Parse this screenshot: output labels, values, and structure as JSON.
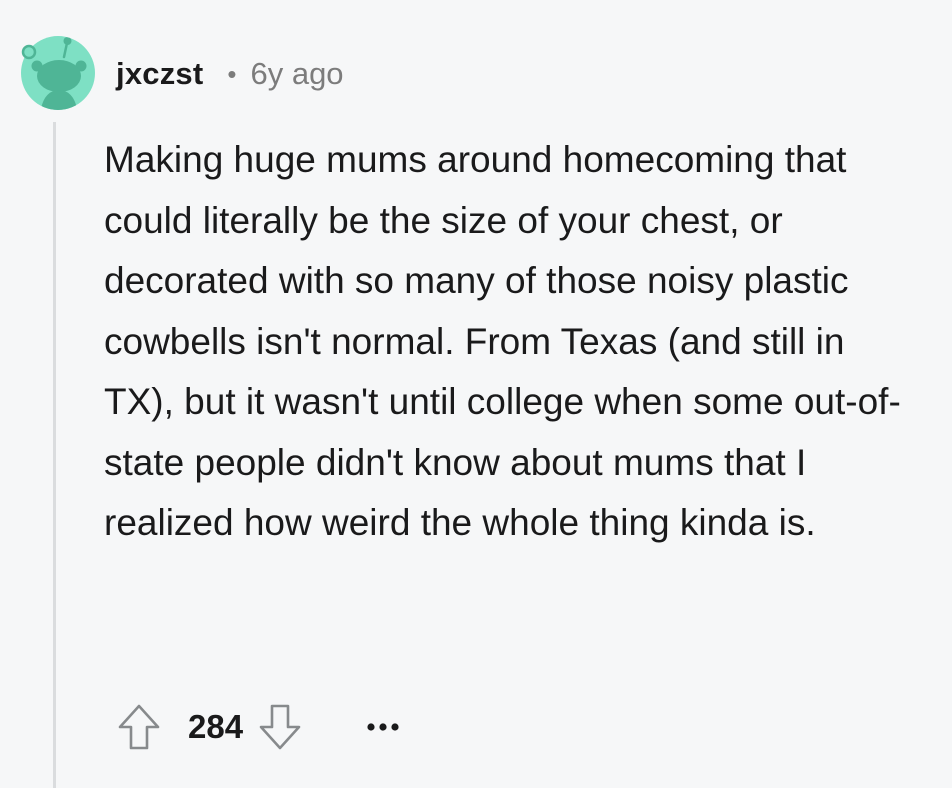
{
  "comment": {
    "author": "jxczst",
    "separator": "•",
    "timestamp": "6y ago",
    "body": "Making huge mums around homecoming that could literally be the size of your chest, or decorated with so many of those noisy plastic cowbells isn't normal. From Texas (and still in TX), but it wasn't until college when some out-of-state people didn't know about mums that I realized how weird the whole thing kinda is.",
    "score": "284"
  },
  "icons": {
    "avatar": "reddit-snoo-avatar-icon",
    "upvote": "arrow-up-icon",
    "downvote": "arrow-down-icon",
    "more": "more-options-icon"
  },
  "colors": {
    "background": "#f6f7f8",
    "avatar_bg": "#7ee0c4",
    "avatar_figure": "#4fb596",
    "text": "#1a1a1b",
    "muted": "#7c7c7c",
    "thread_line": "#dadcde"
  }
}
